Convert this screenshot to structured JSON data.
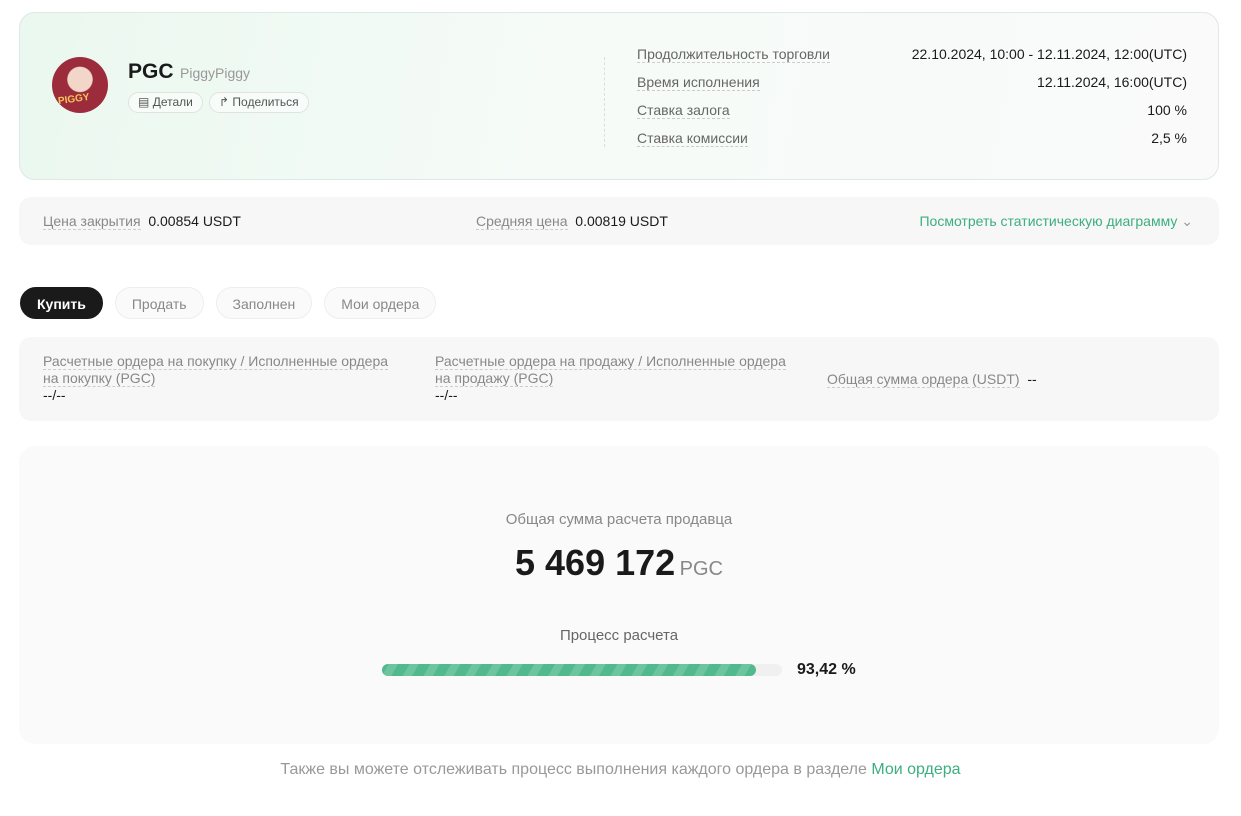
{
  "token": {
    "symbol": "PGC",
    "name": "PiggyPiggy",
    "logo_text": "PIGGY PIGGY",
    "details": "Детали",
    "share": "Поделиться"
  },
  "info": [
    {
      "label": "Продолжительность торговли",
      "value": "22.10.2024, 10:00 - 12.11.2024, 12:00(UTC)"
    },
    {
      "label": "Время исполнения",
      "value": "12.11.2024, 16:00(UTC)"
    },
    {
      "label": "Ставка залога",
      "value": "100 %"
    },
    {
      "label": "Ставка комиссии",
      "value": "2,5 %"
    }
  ],
  "prices": {
    "close_label": "Цена закрытия",
    "close_value": "0.00854 USDT",
    "avg_label": "Средняя цена",
    "avg_value": "0.00819 USDT",
    "chart_link": "Посмотреть статистическую диаграмму"
  },
  "tabs": [
    "Купить",
    "Продать",
    "Заполнен",
    "Мои ордера"
  ],
  "orders": {
    "buy_label": "Расчетные ордера на покупку / Исполненные ордера на покупку (PGC)",
    "buy_value": "--/--",
    "sell_label": "Расчетные ордера на продажу / Исполненные ордера на продажу (PGC)",
    "sell_value": "--/--",
    "total_label": "Общая сумма ордера (USDT)",
    "total_value": "--"
  },
  "settlement": {
    "title": "Общая сумма расчета продавца",
    "amount": "5 469 172",
    "unit": "PGC",
    "progress_label": "Процесс расчета",
    "progress_percent": 93.42,
    "progress_text": "93,42 %"
  },
  "footer": {
    "text": "Также вы можете отслеживать процесс выполнения каждого ордера в разделе ",
    "link": "Мои ордера"
  },
  "colors": {
    "accent": "#3dae7f",
    "progress": "#52b98e"
  }
}
